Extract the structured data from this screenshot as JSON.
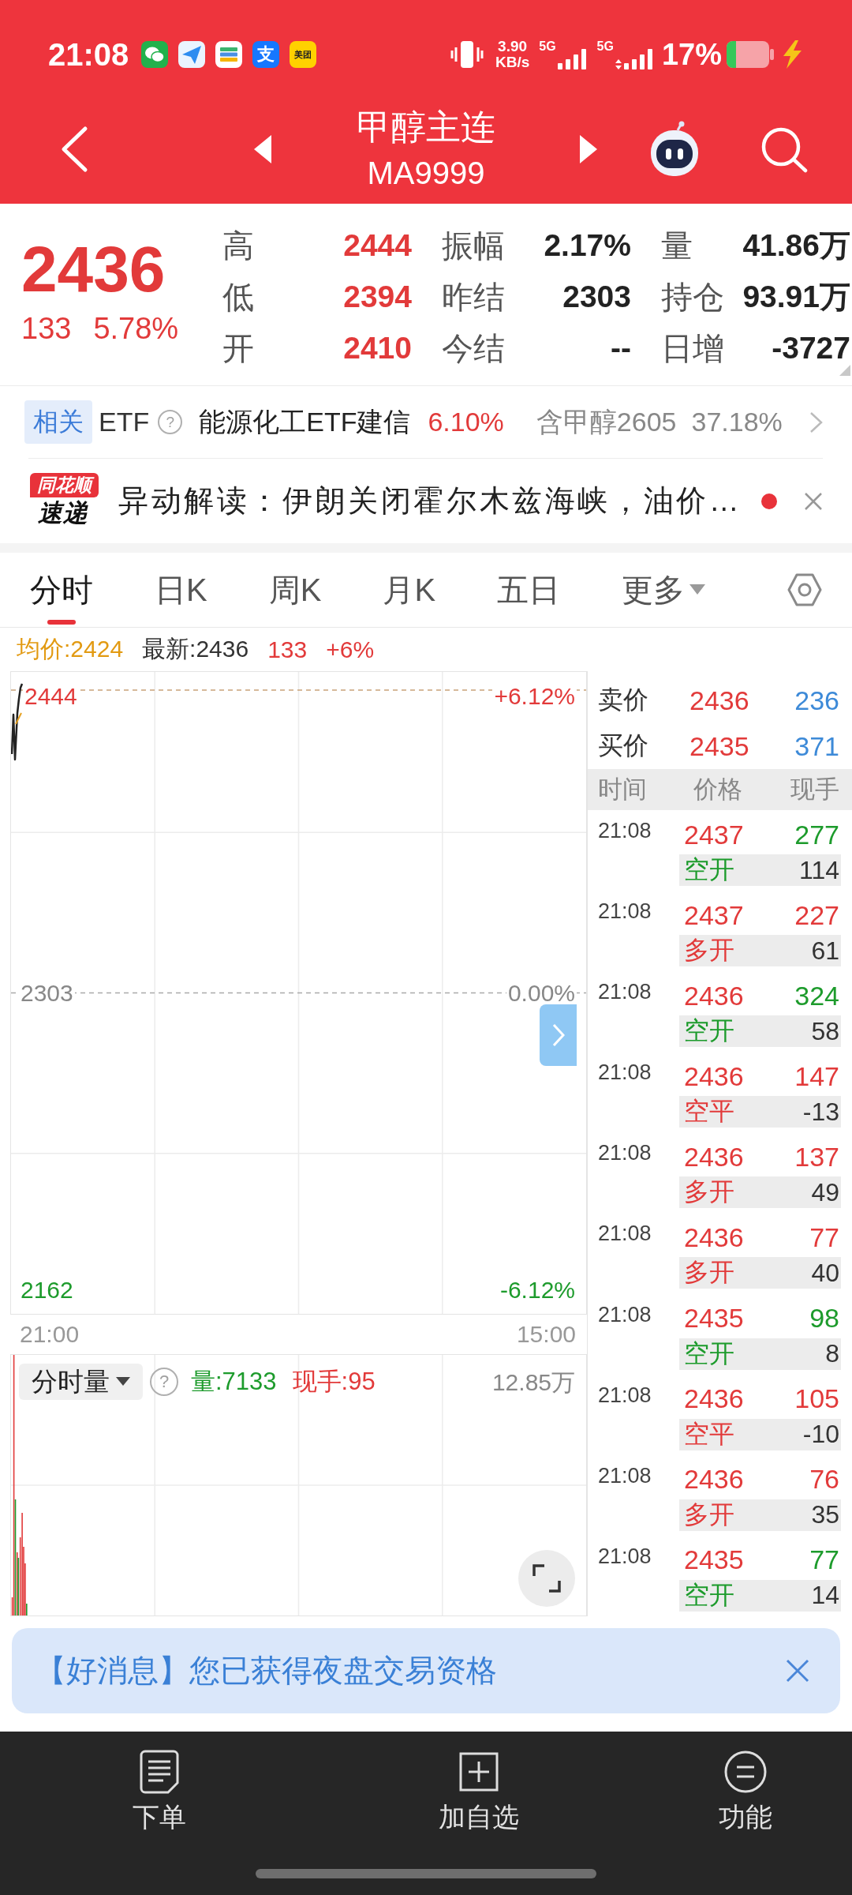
{
  "status_bar": {
    "time": "21:08",
    "app_icons": [
      {
        "kind": "chat"
      },
      {
        "kind": "plane"
      },
      {
        "kind": "cards"
      },
      {
        "kind": "glyph",
        "label": "支",
        "color": "#1677ff"
      },
      {
        "kind": "wordmark",
        "label": "美团",
        "color": "#ffd100"
      }
    ],
    "speed_value": "3.90",
    "speed_unit": "KB/s",
    "signals": [
      {
        "network": "5G",
        "data_arrows": false
      },
      {
        "network": "5G",
        "data_arrows": true
      }
    ],
    "battery": "17%",
    "charging": true
  },
  "header": {
    "title": "甲醇主连",
    "code": "MA9999"
  },
  "quote": {
    "price": "2436",
    "change": "133",
    "change_percent": "5.78%",
    "stats": [
      {
        "label": "高",
        "value": "2444",
        "kind": "price"
      },
      {
        "label": "振幅",
        "value": "2.17%",
        "kind": "plain"
      },
      {
        "label": "量",
        "value": "41.86万",
        "kind": "plain"
      },
      {
        "label": "低",
        "value": "2394",
        "kind": "price"
      },
      {
        "label": "昨结",
        "value": "2303",
        "kind": "plain"
      },
      {
        "label": "持仓",
        "value": "93.91万",
        "kind": "plain"
      },
      {
        "label": "开",
        "value": "2410",
        "kind": "price"
      },
      {
        "label": "今结",
        "value": "--",
        "kind": "plain"
      },
      {
        "label": "日增",
        "value": "-3727",
        "kind": "plain"
      }
    ]
  },
  "etf": {
    "tag": "相关",
    "label": "ETF",
    "help": "?",
    "fund": "能源化工ETF建信",
    "fund_change": "6.10%",
    "holding": "含甲醇2605",
    "holding_percent": "37.18%"
  },
  "news": {
    "source": "同花顺",
    "source_caption": "速递",
    "headline": "异动解读：伊朗关闭霍尔木兹海峡，油价…",
    "unread": true
  },
  "chart_tabs": [
    {
      "label": "分时",
      "selected": true,
      "dropdown": false
    },
    {
      "label": "日K",
      "selected": false,
      "dropdown": false
    },
    {
      "label": "周K",
      "selected": false,
      "dropdown": false
    },
    {
      "label": "月K",
      "selected": false,
      "dropdown": false
    },
    {
      "label": "五日",
      "selected": false,
      "dropdown": false
    },
    {
      "label": "更多",
      "selected": false,
      "dropdown": true
    }
  ],
  "summary": {
    "average": "均价:2424",
    "latest": "最新:2436",
    "change": "133",
    "change_percent": "+6%"
  },
  "price_chart": {
    "price_axis": [
      "2444",
      "2303",
      "2162"
    ],
    "percent_axis": [
      "+6.12%",
      "0.00%",
      "-6.12%"
    ],
    "time_axis": [
      "21:00",
      "15:00"
    ]
  },
  "volume_chart": {
    "selector": "分时量",
    "help": "?",
    "volume": "量:7133",
    "last_volume": "现手:95",
    "max": "12.85万"
  },
  "order_book": {
    "quotes": [
      {
        "label": "卖价",
        "price": "2436",
        "size": "236"
      },
      {
        "label": "买价",
        "price": "2435",
        "size": "371"
      }
    ],
    "columns": [
      "时间",
      "价格",
      "现手"
    ],
    "trades": [
      {
        "time": "21:08",
        "price": "2437",
        "size": "277",
        "color": "#1d9b2c",
        "action": "空开",
        "quantity": "114"
      },
      {
        "time": "21:08",
        "price": "2437",
        "size": "227",
        "color": "#e23a3a",
        "action": "多开",
        "quantity": "61"
      },
      {
        "time": "21:08",
        "price": "2436",
        "size": "324",
        "color": "#1d9b2c",
        "action": "空开",
        "quantity": "58"
      },
      {
        "time": "21:08",
        "price": "2436",
        "size": "147",
        "color": "#e23a3a",
        "action": "空平",
        "quantity": "-13"
      },
      {
        "time": "21:08",
        "price": "2436",
        "size": "137",
        "color": "#e23a3a",
        "action": "多开",
        "quantity": "49"
      },
      {
        "time": "21:08",
        "price": "2436",
        "size": "77",
        "color": "#e23a3a",
        "action": "多开",
        "quantity": "40"
      },
      {
        "time": "21:08",
        "price": "2435",
        "size": "98",
        "color": "#1d9b2c",
        "action": "空开",
        "quantity": "8"
      },
      {
        "time": "21:08",
        "price": "2436",
        "size": "105",
        "color": "#e23a3a",
        "action": "空平",
        "quantity": "-10"
      },
      {
        "time": "21:08",
        "price": "2436",
        "size": "76",
        "color": "#e23a3a",
        "action": "多开",
        "quantity": "35"
      },
      {
        "time": "21:08",
        "price": "2435",
        "size": "77",
        "color": "#1d9b2c",
        "action": "空开",
        "quantity": "14"
      }
    ]
  },
  "notice": {
    "text": "【好消息】您已获得夜盘交易资格"
  },
  "bottom_nav": [
    {
      "label": "下单",
      "kind": "order"
    },
    {
      "label": "加自选",
      "kind": "add"
    },
    {
      "label": "功能",
      "kind": "menu"
    }
  ]
}
